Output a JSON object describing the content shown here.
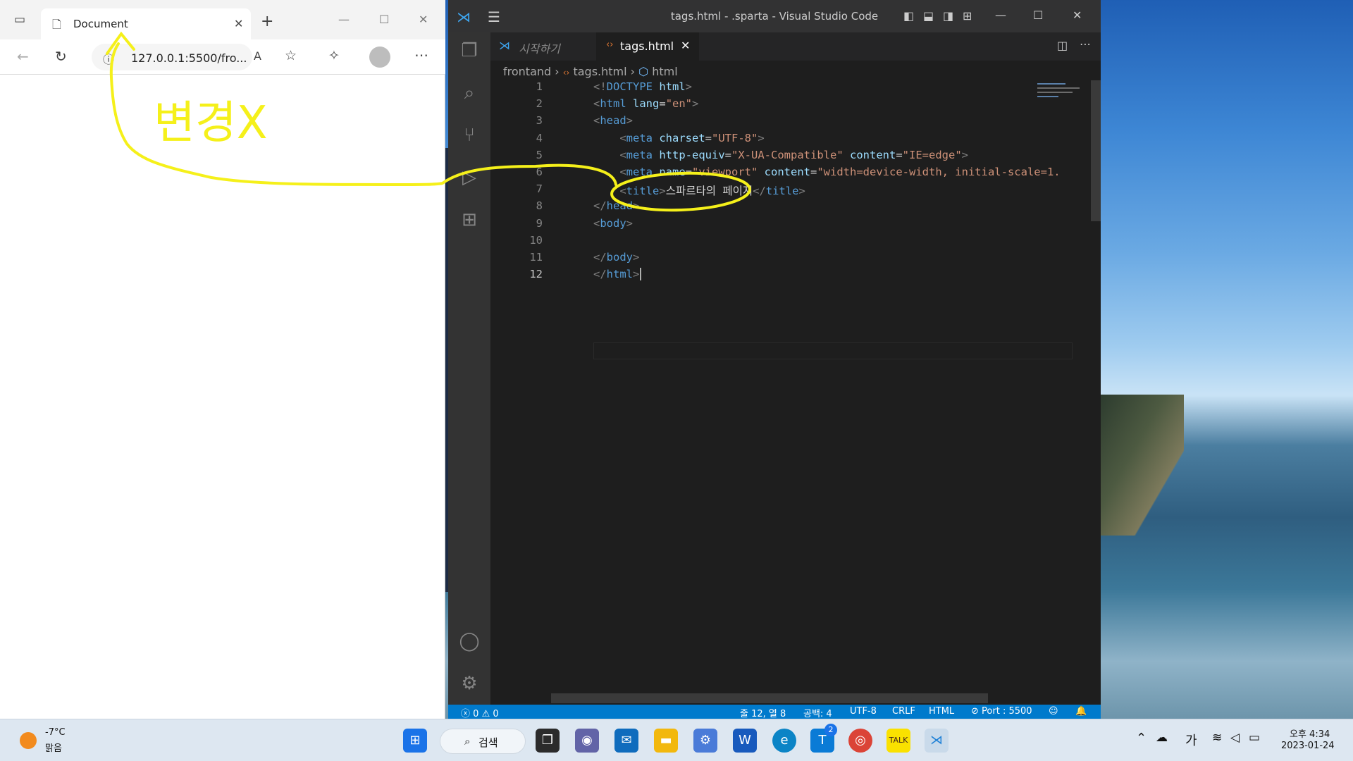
{
  "browser": {
    "tab_title": "Document",
    "url": "127.0.0.1:5500/fro..."
  },
  "vscode": {
    "window_title": "tags.html - .sparta - Visual Studio Code",
    "tabs": [
      {
        "label": "시작하기",
        "active": false
      },
      {
        "label": "tags.html",
        "active": true
      }
    ],
    "breadcrumb": {
      "folder": "frontand",
      "file": "tags.html",
      "symbol": "html"
    },
    "lines": [
      {
        "num": "1",
        "tokens": [
          [
            "t-punc",
            "<!"
          ],
          [
            "t-tag",
            "DOCTYPE "
          ],
          [
            "t-attr",
            "html"
          ],
          [
            "t-punc",
            ">"
          ]
        ]
      },
      {
        "num": "2",
        "tokens": [
          [
            "t-punc",
            "<"
          ],
          [
            "t-tag",
            "html "
          ],
          [
            "t-attr",
            "lang"
          ],
          [
            "t-text",
            "="
          ],
          [
            "t-str",
            "\"en\""
          ],
          [
            "t-punc",
            ">"
          ]
        ]
      },
      {
        "num": "3",
        "tokens": [
          [
            "t-punc",
            "<"
          ],
          [
            "t-tag",
            "head"
          ],
          [
            "t-punc",
            ">"
          ]
        ]
      },
      {
        "num": "4",
        "tokens": [
          [
            "t-text",
            "    "
          ],
          [
            "t-punc",
            "<"
          ],
          [
            "t-tag",
            "meta "
          ],
          [
            "t-attr",
            "charset"
          ],
          [
            "t-text",
            "="
          ],
          [
            "t-str",
            "\"UTF-8\""
          ],
          [
            "t-punc",
            ">"
          ]
        ]
      },
      {
        "num": "5",
        "tokens": [
          [
            "t-text",
            "    "
          ],
          [
            "t-punc",
            "<"
          ],
          [
            "t-tag",
            "meta "
          ],
          [
            "t-attr",
            "http-equiv"
          ],
          [
            "t-text",
            "="
          ],
          [
            "t-str",
            "\"X-UA-Compatible\" "
          ],
          [
            "t-attr",
            "content"
          ],
          [
            "t-text",
            "="
          ],
          [
            "t-str",
            "\"IE=edge\""
          ],
          [
            "t-punc",
            ">"
          ]
        ]
      },
      {
        "num": "6",
        "tokens": [
          [
            "t-text",
            "    "
          ],
          [
            "t-punc",
            "<"
          ],
          [
            "t-tag",
            "meta "
          ],
          [
            "t-attr",
            "name"
          ],
          [
            "t-text",
            "="
          ],
          [
            "t-str",
            "\"viewport\" "
          ],
          [
            "t-attr",
            "content"
          ],
          [
            "t-text",
            "="
          ],
          [
            "t-str",
            "\"width=device-width, initial-scale=1."
          ]
        ]
      },
      {
        "num": "7",
        "tokens": [
          [
            "t-text",
            "    "
          ],
          [
            "t-punc",
            "<"
          ],
          [
            "t-tag",
            "title"
          ],
          [
            "t-punc",
            ">"
          ],
          [
            "t-text",
            "스파르타의 페이지"
          ],
          [
            "t-punc",
            "</"
          ],
          [
            "t-tag",
            "title"
          ],
          [
            "t-punc",
            ">"
          ]
        ]
      },
      {
        "num": "8",
        "tokens": [
          [
            "t-punc",
            "</"
          ],
          [
            "t-tag",
            "head"
          ],
          [
            "t-punc",
            ">"
          ]
        ]
      },
      {
        "num": "9",
        "tokens": [
          [
            "t-punc",
            "<"
          ],
          [
            "t-tag",
            "body"
          ],
          [
            "t-punc",
            ">"
          ]
        ]
      },
      {
        "num": "10",
        "tokens": []
      },
      {
        "num": "11",
        "tokens": [
          [
            "t-punc",
            "</"
          ],
          [
            "t-tag",
            "body"
          ],
          [
            "t-punc",
            ">"
          ]
        ]
      },
      {
        "num": "12",
        "tokens": [
          [
            "t-punc",
            "</"
          ],
          [
            "t-tag",
            "html"
          ],
          [
            "t-punc",
            ">"
          ]
        ]
      }
    ],
    "status": {
      "errors": "0",
      "warnings": "0",
      "position": "줄 12, 열 8",
      "spaces": "공백: 4",
      "encoding": "UTF-8",
      "eol": "CRLF",
      "language": "HTML",
      "port": "Port : 5500"
    }
  },
  "annotation": {
    "text": "변경X",
    "color": "#f5f01a"
  },
  "taskbar": {
    "weather_temp": "-7°C",
    "weather_desc": "맑음",
    "search_label": "검색",
    "badge_count": "2",
    "ime": "가",
    "time": "오후 4:34",
    "date": "2023-01-24"
  }
}
